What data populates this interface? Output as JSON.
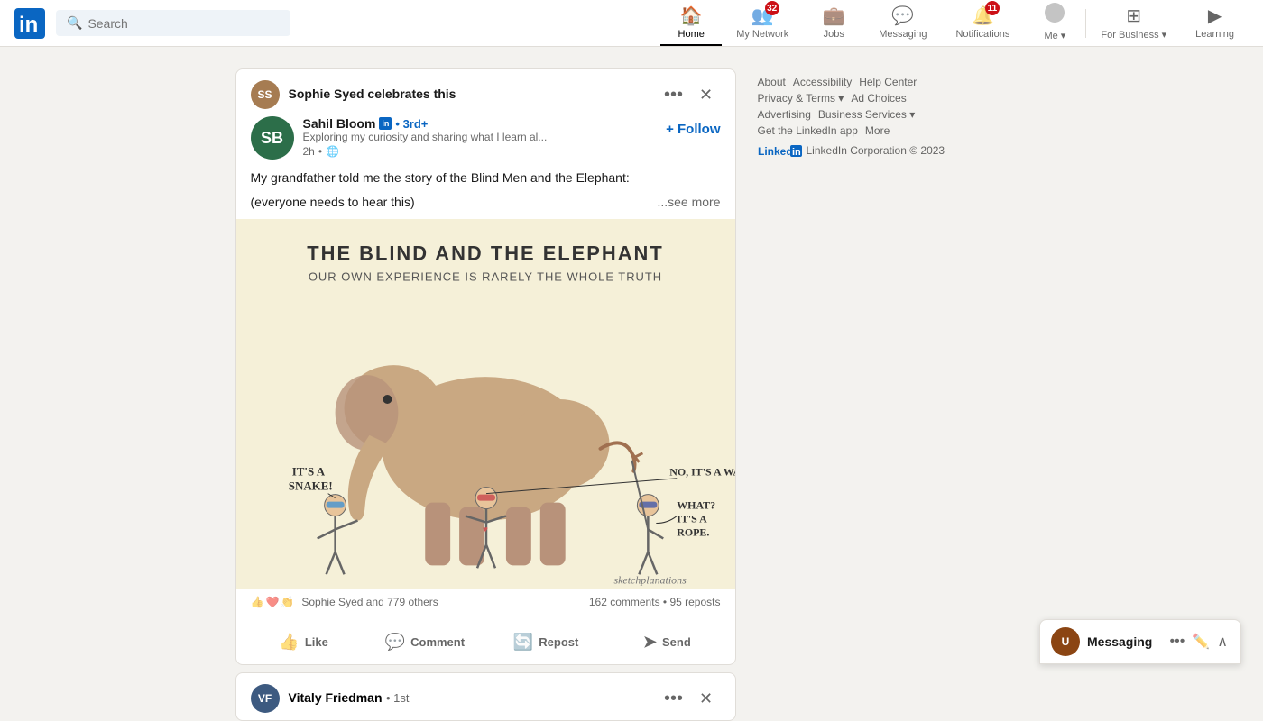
{
  "nav": {
    "search_placeholder": "Search",
    "items": [
      {
        "id": "home",
        "label": "Home",
        "icon": "🏠",
        "active": true,
        "badge": null
      },
      {
        "id": "network",
        "label": "My Network",
        "icon": "👥",
        "active": false,
        "badge": "32"
      },
      {
        "id": "jobs",
        "label": "Jobs",
        "icon": "💼",
        "active": false,
        "badge": null
      },
      {
        "id": "messaging",
        "label": "Messaging",
        "icon": "💬",
        "active": false,
        "badge": null
      },
      {
        "id": "notifications",
        "label": "Notifications",
        "icon": "🔔",
        "active": false,
        "badge": "11"
      },
      {
        "id": "me",
        "label": "Me ▾",
        "icon": "👤",
        "active": false,
        "badge": null
      },
      {
        "id": "business",
        "label": "For Business ▾",
        "icon": "⊞",
        "active": false,
        "badge": null
      },
      {
        "id": "learning",
        "label": "Learning",
        "icon": "▶",
        "active": false,
        "badge": null
      }
    ]
  },
  "post": {
    "celebrator": "Sophie Syed",
    "celebrates": "celebrates this",
    "author_name": "Sahil Bloom",
    "author_badge": "in",
    "author_degree": "• 3rd+",
    "author_tagline": "Exploring my curiosity and sharing what I learn al...",
    "post_time": "2h",
    "follow_label": "+ Follow",
    "post_text_line1": "My grandfather told me the story of the Blind Men and the Elephant:",
    "post_text_line2": "(everyone needs to hear this)",
    "see_more": "...see more",
    "reactions_label": "Sophie Syed and 779 others",
    "comments_label": "162 comments",
    "reposts_label": "95 reposts",
    "actions": [
      {
        "id": "like",
        "icon": "👍",
        "label": "Like"
      },
      {
        "id": "comment",
        "icon": "💬",
        "label": "Comment"
      },
      {
        "id": "repost",
        "icon": "🔄",
        "label": "Repost"
      },
      {
        "id": "send",
        "icon": "➤",
        "label": "Send"
      }
    ]
  },
  "vitaly": {
    "name": "Vitaly Friedman",
    "degree": "• 1st"
  },
  "footer": {
    "links": [
      "About",
      "Accessibility",
      "Help Center",
      "Privacy & Terms ▾",
      "Ad Choices",
      "Advertising",
      "Business Services ▾",
      "Get the LinkedIn app",
      "More"
    ],
    "copyright": "LinkedIn Corporation © 2023"
  },
  "messaging": {
    "label": "Messaging",
    "online_indicator": true
  },
  "image": {
    "title": "THE BLIND AND THE ELEPHANT",
    "subtitle": "OUR OWN EXPERIENCE IS RARELY THE WHOLE TRUTH",
    "caption1": "IT'S A SNAKE!",
    "caption2": "NO, IT'S A WALL",
    "caption3": "WHAT? IT'S A ROPE.",
    "watermark": "sketchplanations"
  }
}
